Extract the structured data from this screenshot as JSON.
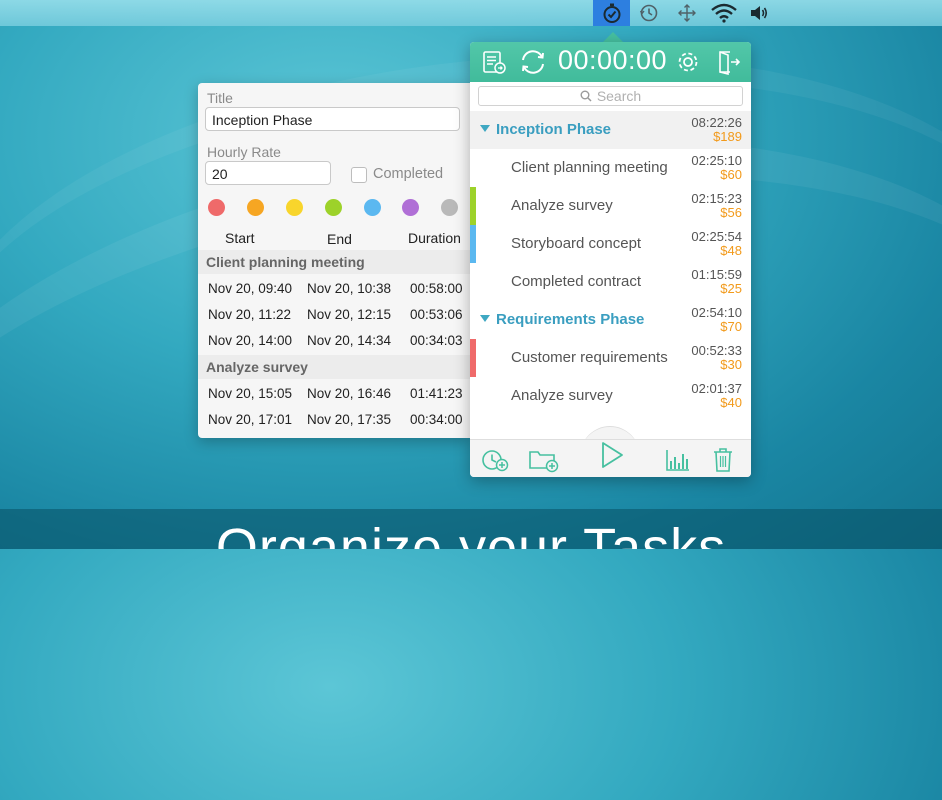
{
  "menubar": {
    "icons": [
      "stopwatch-icon",
      "time-machine-icon",
      "arrows-icon",
      "wifi-icon",
      "volume-icon"
    ]
  },
  "details": {
    "title_label": "Title",
    "title_value": "Inception Phase",
    "rate_label": "Hourly Rate",
    "rate_value": "20",
    "completed_label": "Completed",
    "colors": [
      "#ef6a6a",
      "#f6a623",
      "#f8d52c",
      "#9dd22a",
      "#5bb8f0",
      "#b06fd6",
      "#b9b9b9"
    ],
    "columns": {
      "start": "Start",
      "end": "End",
      "duration": "Duration"
    },
    "groups": [
      {
        "name": "Client planning meeting",
        "rows": [
          {
            "start": "Nov 20, 09:40",
            "end": "Nov 20, 10:38",
            "duration": "00:58:00"
          },
          {
            "start": "Nov 20, 11:22",
            "end": "Nov 20, 12:15",
            "duration": "00:53:06"
          },
          {
            "start": "Nov 20, 14:00",
            "end": "Nov 20, 14:34",
            "duration": "00:34:03"
          }
        ]
      },
      {
        "name": "Analyze survey",
        "rows": [
          {
            "start": "Nov 20, 15:05",
            "end": "Nov 20, 16:46",
            "duration": "01:41:23"
          },
          {
            "start": "Nov 20, 17:01",
            "end": "Nov 20, 17:35",
            "duration": "00:34:00"
          }
        ]
      }
    ]
  },
  "tracker": {
    "timer": "00:00:00",
    "search_placeholder": "Search",
    "accent": "#46c0a0",
    "items": [
      {
        "kind": "phase",
        "name": "Inception Phase",
        "time": "08:22:26",
        "cost": "$189"
      },
      {
        "kind": "task",
        "name": "Client planning meeting",
        "time": "02:25:10",
        "cost": "$60",
        "color": ""
      },
      {
        "kind": "task",
        "name": "Analyze survey",
        "time": "02:15:23",
        "cost": "$56",
        "color": "#9dd22a"
      },
      {
        "kind": "task",
        "name": "Storyboard concept",
        "time": "02:25:54",
        "cost": "$48",
        "color": "#5bb8f0"
      },
      {
        "kind": "task",
        "name": "Completed contract",
        "time": "01:15:59",
        "cost": "$25",
        "color": ""
      },
      {
        "kind": "phase",
        "name": "Requirements Phase",
        "time": "02:54:10",
        "cost": "$70"
      },
      {
        "kind": "task",
        "name": "Customer requirements",
        "time": "00:52:33",
        "cost": "$30",
        "color": "#ef6a6a"
      },
      {
        "kind": "task",
        "name": "Analyze survey",
        "time": "02:01:37",
        "cost": "$40",
        "color": ""
      }
    ]
  },
  "headline": "Organize your Tasks"
}
